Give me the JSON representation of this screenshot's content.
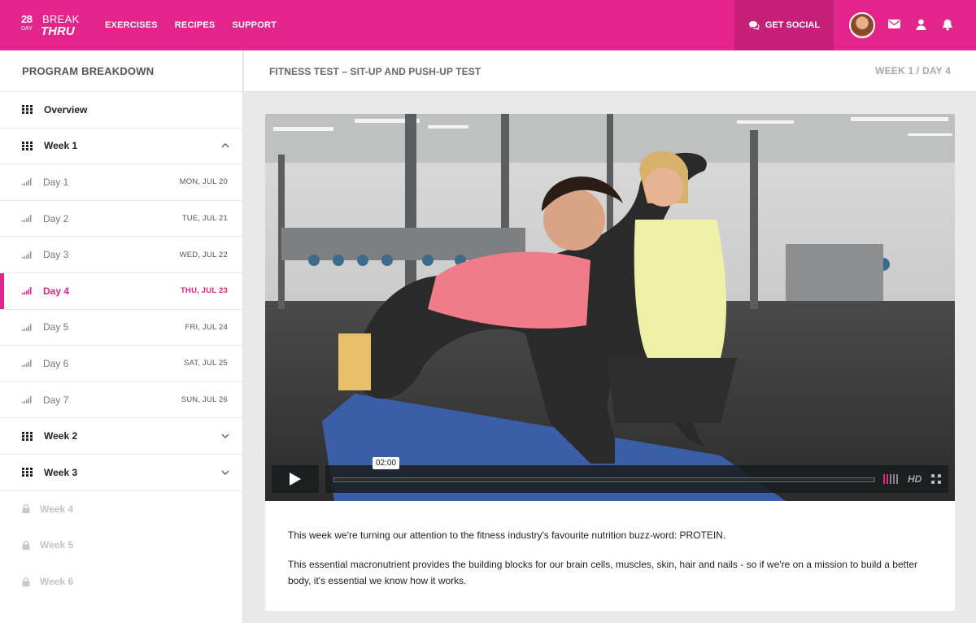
{
  "brand": {
    "logo_28": "28",
    "logo_day": "DAY",
    "logo_break": "BREAK",
    "logo_thru": "THRU"
  },
  "nav": [
    "EXERCISES",
    "RECIPES",
    "SUPPORT"
  ],
  "social_label": "GET SOCIAL",
  "sidebar": {
    "title": "PROGRAM BREAKDOWN",
    "overview": "Overview",
    "week1": "Week 1",
    "days": [
      {
        "label": "Day 1",
        "date": "MON, JUL 20"
      },
      {
        "label": "Day 2",
        "date": "TUE, JUL 21"
      },
      {
        "label": "Day 3",
        "date": "WED, JUL 22"
      },
      {
        "label": "Day 4",
        "date": "THU, JUL 23"
      },
      {
        "label": "Day 5",
        "date": "FRI, JUL 24"
      },
      {
        "label": "Day 6",
        "date": "SAT, JUL 25"
      },
      {
        "label": "Day 7",
        "date": "SUN, JUL 26"
      }
    ],
    "week2": "Week 2",
    "week3": "Week 3",
    "locked": [
      "Week 4",
      "Week 5",
      "Week 6"
    ]
  },
  "content": {
    "title": "FITNESS TEST – SIT-UP AND PUSH-UP TEST",
    "week_day": "WEEK 1 / DAY 4",
    "video": {
      "time": "02:00",
      "hd": "HD"
    },
    "paragraphs": [
      "This week we're turning our attention to the fitness industry's favourite nutrition buzz-word: PROTEIN.",
      "This essential macronutrient provides the building blocks for our brain cells, muscles, skin, hair and nails - so if we're on a mission to build a better body, it's essential we know how it works."
    ]
  },
  "colors": {
    "brand_pink": "#e2248b",
    "social_bg": "#c51f79"
  }
}
